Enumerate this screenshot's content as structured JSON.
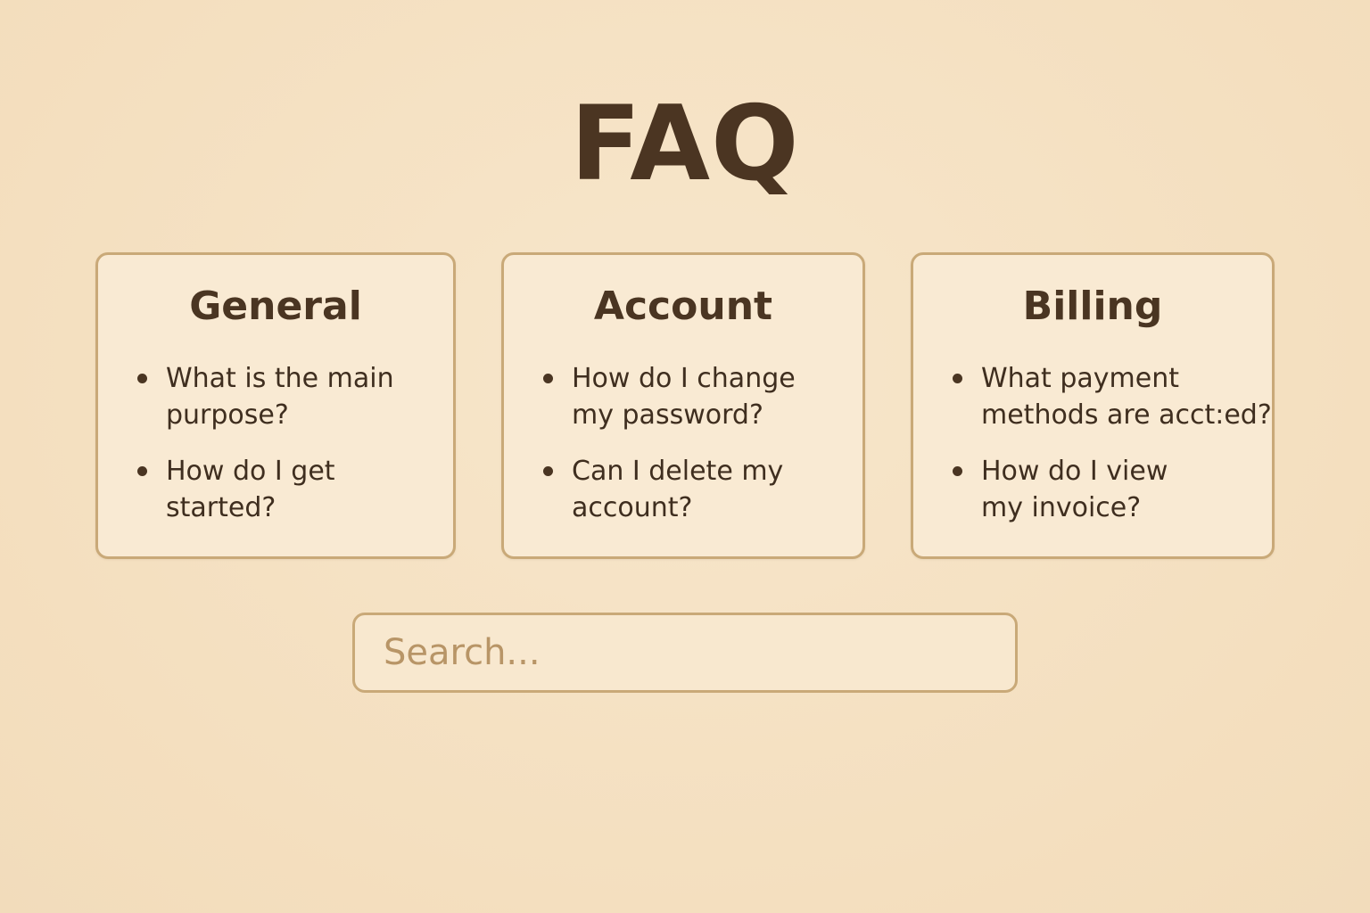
{
  "page": {
    "title": "FAQ"
  },
  "categories": [
    {
      "title": "General",
      "questions": [
        {
          "line1": "What is the main",
          "line2": "purpose?"
        },
        {
          "line1": "How do I get",
          "line2": "started?"
        }
      ]
    },
    {
      "title": "Account",
      "questions": [
        {
          "line1": "How do I change",
          "line2": "my password?"
        },
        {
          "line1": "Can I delete my",
          "line2": "account?"
        }
      ]
    },
    {
      "title": "Billing",
      "questions": [
        {
          "line1": "What payment",
          "line2": "methods are acct:ed?"
        },
        {
          "line1": "How do I view",
          "line2": "my invoice?"
        }
      ]
    }
  ],
  "search": {
    "placeholder": "Search...",
    "value": ""
  },
  "colors": {
    "background": "#f5e1c2",
    "card_background": "#f9ead3",
    "border": "#c9a978",
    "text": "#4a3522",
    "placeholder": "#b89567"
  }
}
